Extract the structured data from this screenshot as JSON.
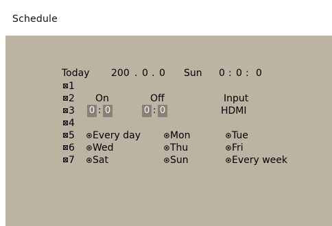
{
  "window": {
    "title": "Schedule"
  },
  "today": {
    "label": "Today",
    "year": "200",
    "sep1": ".",
    "month": "0",
    "sep2": ".",
    "day": "0",
    "weekday": "Sun",
    "hour": "0",
    "c1": ":",
    "minute": "0",
    "c2": ":",
    "second": "0"
  },
  "rows": [
    "1",
    "2",
    "3",
    "4",
    "5",
    "6",
    "7"
  ],
  "headers": {
    "on": "On",
    "off": "Off",
    "input": "Input"
  },
  "times": {
    "on_hour": "0",
    "on_minute": "0",
    "on_colon": ":",
    "off_hour": "0",
    "off_minute": "0",
    "off_colon": ":"
  },
  "input_value": "HDMI",
  "repeat_options": [
    "Every day",
    "Mon",
    "Tue",
    "Wed",
    "Thu",
    "Fri",
    "Sat",
    "Sun",
    "Every week"
  ],
  "colors": {
    "panel_bg": "#bcb3a2",
    "time_field_bg": "#8c7f77",
    "time_field_text": "#ffffff"
  },
  "icons": {
    "row_checkbox": "checkbox-x-icon",
    "repeat_radio": "radio-icon"
  }
}
